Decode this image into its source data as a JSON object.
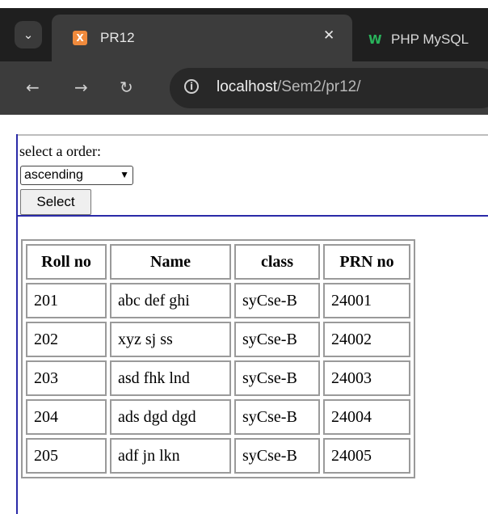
{
  "browser": {
    "tabs": [
      {
        "title": "PR12",
        "active": true,
        "favicon": "xampp-icon"
      },
      {
        "title": "PHP MySQL",
        "active": false,
        "favicon": "w3schools-icon"
      }
    ],
    "address": {
      "host": "localhost",
      "path": "/Sem2/pr12/"
    }
  },
  "form": {
    "label": "select a order:",
    "select_value": "ascending",
    "button_label": "Select"
  },
  "table": {
    "headers": [
      "Roll no",
      "Name",
      "class",
      "PRN no"
    ],
    "rows": [
      [
        "201",
        "abc def ghi",
        "syCse-B",
        "24001"
      ],
      [
        "202",
        "xyz sj ss",
        "syCse-B",
        "24002"
      ],
      [
        "203",
        "asd fhk lnd",
        "syCse-B",
        "24003"
      ],
      [
        "204",
        "ads dgd dgd",
        "syCse-B",
        "24004"
      ],
      [
        "205",
        "adf jn lkn",
        "syCse-B",
        "24005"
      ]
    ]
  }
}
